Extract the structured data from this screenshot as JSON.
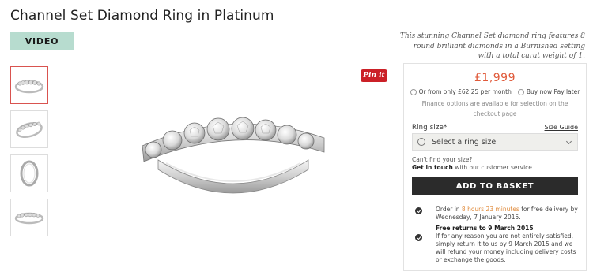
{
  "product": {
    "title": "Channel Set Diamond Ring in Platinum",
    "video_label": "VIDEO",
    "pinit_label": "Pin it",
    "description": "This stunning Channel Set diamond ring features 8 round brilliant diamonds in a Burnished setting with a total carat weight of 1."
  },
  "thumbnails": [
    {
      "name": "front-view"
    },
    {
      "name": "angled-view"
    },
    {
      "name": "side-profile-view"
    },
    {
      "name": "flat-view"
    }
  ],
  "purchase": {
    "price": "£1,999",
    "finance_link": "Or from only £62.25 per month",
    "buy_now_link": "Buy now Pay later",
    "finance_note": "Finance options are available for selection on the checkout page",
    "ring_size_label": "Ring size*",
    "size_guide_label": "Size Guide",
    "select_placeholder": "Select a ring size",
    "cant_find": "Can't find your size?",
    "get_in_touch": "Get in touch",
    "get_in_touch_rest": " with our customer service.",
    "add_to_basket": "ADD TO BASKET"
  },
  "delivery": {
    "order_prefix": "Order in ",
    "countdown": "8 hours 23 minutes",
    "order_suffix": " for free delivery by Wednesday, 7 January 2015."
  },
  "returns": {
    "title": "Free returns to 9 March 2015",
    "body": "If for any reason you are not entirely satisfied, simply return it to us by 9 March 2015 and we will refund your money including delivery costs or exchange the goods."
  },
  "colors": {
    "accent_price": "#e05a3a",
    "video_bg": "#b7dccf",
    "pinterest": "#cb2027",
    "button_dark": "#2b2b2b"
  }
}
